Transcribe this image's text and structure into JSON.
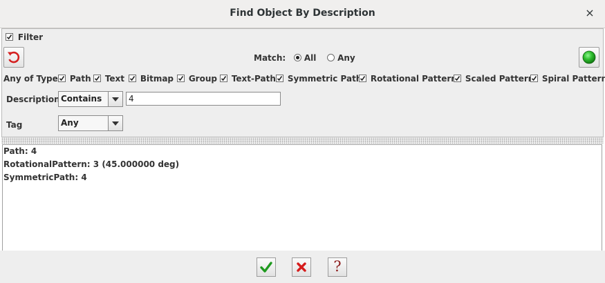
{
  "window": {
    "title": "Find Object By Description",
    "close_glyph": "×"
  },
  "filter": {
    "label": "Filter",
    "checked": true
  },
  "reset_icon": "undo-icon",
  "status_icon": "green-status-icon",
  "status_color": "#2fbe2f",
  "match": {
    "label": "Match:",
    "options": [
      {
        "label": "All",
        "selected": true
      },
      {
        "label": "Any",
        "selected": false
      }
    ]
  },
  "types": {
    "label": "Any of Type:",
    "items": [
      {
        "label": "Path",
        "checked": true
      },
      {
        "label": "Text",
        "checked": true
      },
      {
        "label": "Bitmap",
        "checked": true
      },
      {
        "label": "Group",
        "checked": true
      },
      {
        "label": "Text-Path",
        "checked": true
      },
      {
        "label": "Symmetric Path",
        "checked": true
      },
      {
        "label": "Rotational Pattern",
        "checked": true
      },
      {
        "label": "Scaled Pattern",
        "checked": true
      },
      {
        "label": "Spiral Pattern",
        "checked": true
      }
    ]
  },
  "description": {
    "label": "Description",
    "mode": "Contains",
    "value": "4"
  },
  "tag": {
    "label": "Tag",
    "value": "Any"
  },
  "results": [
    "Path: 4",
    "RotationalPattern: 3 (45.000000 deg)",
    "SymmetricPath: 4"
  ],
  "buttons": {
    "ok_icon": "check-icon",
    "cancel_icon": "x-icon",
    "help_label": "?"
  },
  "colors": {
    "ok": "#1f9a1f",
    "cancel": "#d61c1c",
    "help": "#8b1a1a",
    "reset": "#d42020"
  }
}
